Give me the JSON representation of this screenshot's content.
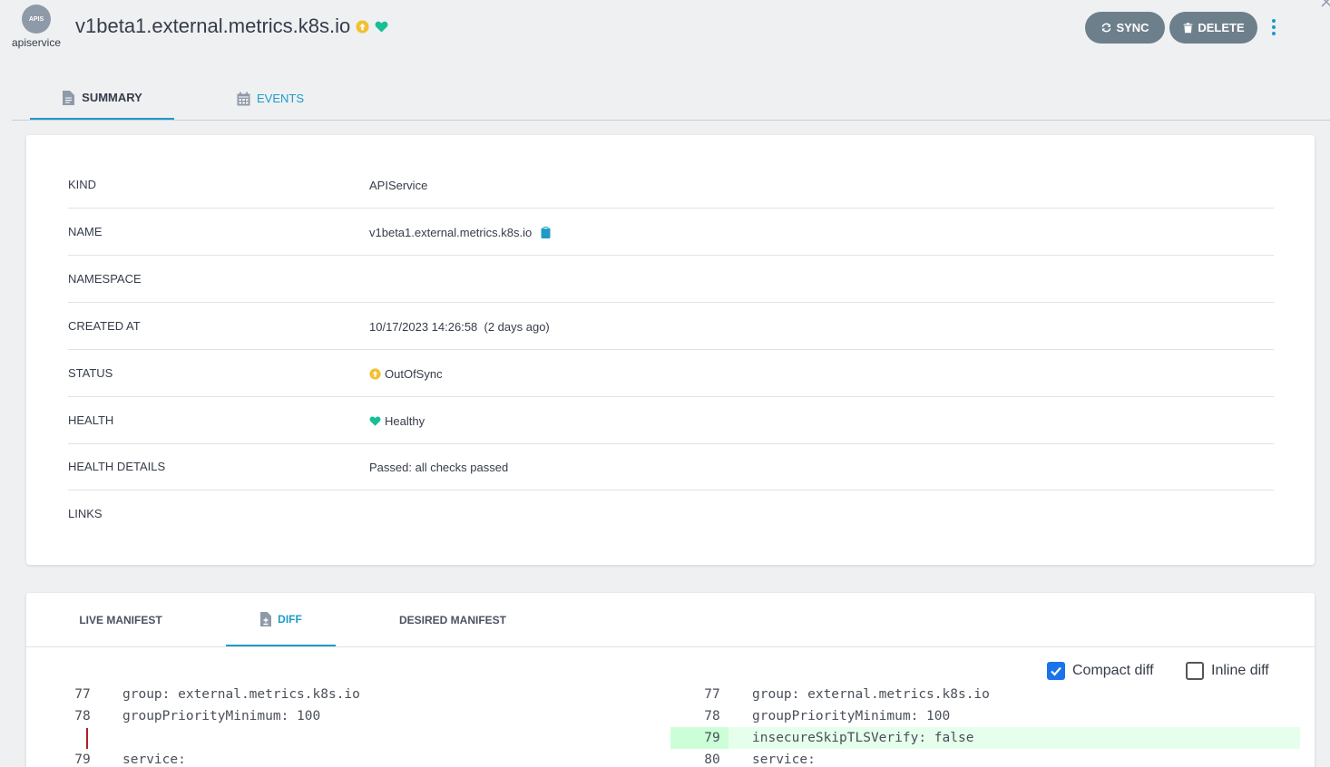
{
  "header": {
    "icon_text": "APIS",
    "kind": "apiservice",
    "title": "v1beta1.external.metrics.k8s.io",
    "sync_label": "SYNC",
    "delete_label": "DELETE"
  },
  "tabs": {
    "summary": "SUMMARY",
    "events": "EVENTS"
  },
  "summary": {
    "rows": [
      {
        "key": "KIND",
        "value": "APIService"
      },
      {
        "key": "NAME",
        "value": "v1beta1.external.metrics.k8s.io"
      },
      {
        "key": "NAMESPACE",
        "value": ""
      },
      {
        "key": "CREATED AT",
        "value": "10/17/2023 14:26:58  (2 days ago)"
      },
      {
        "key": "STATUS",
        "value": "OutOfSync"
      },
      {
        "key": "HEALTH",
        "value": "Healthy"
      },
      {
        "key": "HEALTH DETAILS",
        "value": "Passed: all checks passed"
      },
      {
        "key": "LINKS",
        "value": ""
      }
    ]
  },
  "manifest": {
    "tabs": {
      "live": "LIVE MANIFEST",
      "diff": "DIFF",
      "desired": "DESIRED MANIFEST"
    },
    "compact_diff_label": "Compact diff",
    "compact_diff_checked": true,
    "inline_diff_label": "Inline diff",
    "inline_diff_checked": false,
    "left": [
      {
        "n": "77",
        "text": "group: external.metrics.k8s.io"
      },
      {
        "n": "78",
        "text": "groupPriorityMinimum: 100"
      },
      {
        "n": "79",
        "text": "service:"
      }
    ],
    "right": [
      {
        "n": "77",
        "text": "group: external.metrics.k8s.io"
      },
      {
        "n": "78",
        "text": "groupPriorityMinimum: 100"
      },
      {
        "n": "79",
        "text": "insecureSkipTLSVerify: false"
      },
      {
        "n": "80",
        "text": "service:"
      }
    ]
  },
  "colors": {
    "accent": "#1f9ac9",
    "out_of_sync": "#f4c030",
    "healthy": "#18be94",
    "button_bg": "#6d7f8b",
    "diff_added_bg": "#e6ffec",
    "diff_removed_marker": "#b31d28"
  },
  "icons": {
    "status": "arrow-circle-up-icon",
    "health": "heart-icon",
    "sync": "sync-icon",
    "delete": "trash-icon",
    "more": "kebab-menu-icon",
    "copy": "clipboard-icon",
    "summary_tab": "file-icon",
    "events_tab": "calendar-icon",
    "diff_tab": "file-diff-icon"
  }
}
